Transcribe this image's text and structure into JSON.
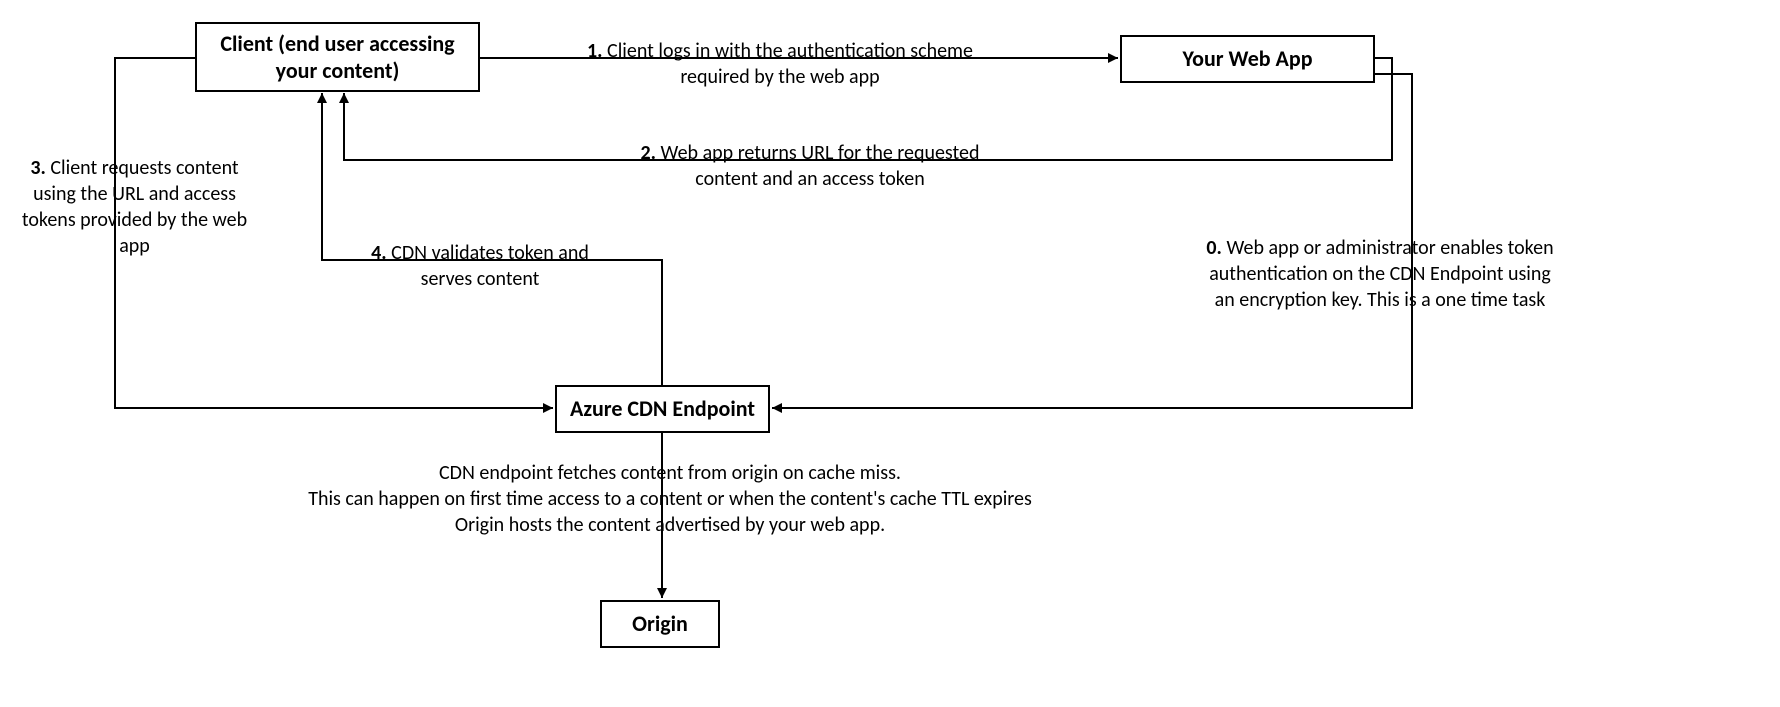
{
  "nodes": {
    "client": "Client (end user accessing your content)",
    "webapp": "Your Web App",
    "cdn": "Azure CDN Endpoint",
    "origin": "Origin"
  },
  "steps": {
    "s0": {
      "num": "0.",
      "text": "Web app or administrator enables token authentication on the CDN Endpoint using an encryption key. This is a one time task"
    },
    "s1": {
      "num": "1.",
      "text": "Client logs in with the authentication scheme required by the web app"
    },
    "s2": {
      "num": "2.",
      "text": "Web app returns URL for the requested content and an access token"
    },
    "s3": {
      "num": "3.",
      "text": "Client requests content using the URL and access tokens provided by the web app"
    },
    "s4": {
      "num": "4.",
      "text": "CDN validates token and serves content"
    }
  },
  "origin_note": "CDN endpoint fetches content from origin on cache miss.\nThis can happen on first time access to a content or when the content's cache TTL expires\nOrigin hosts the content advertised by your web app."
}
